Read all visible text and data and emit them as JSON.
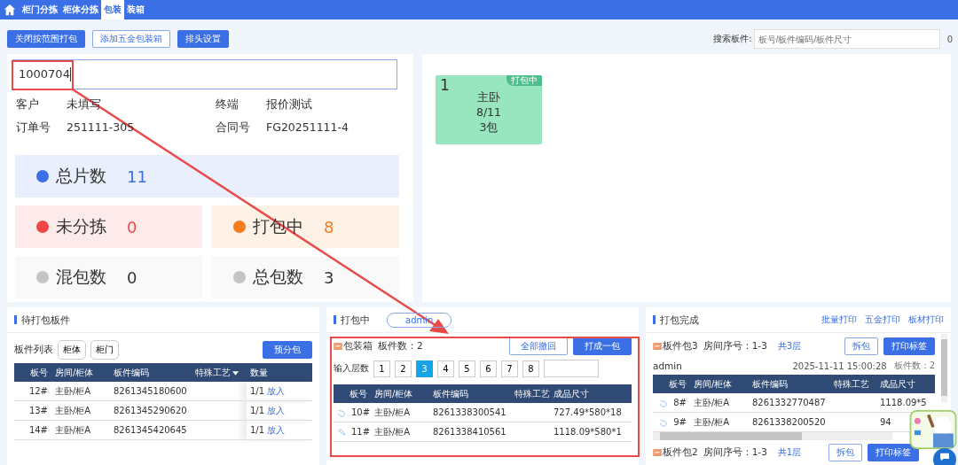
{
  "nav": {
    "tabs": [
      {
        "label": "柜门分拣",
        "selected": false
      },
      {
        "label": "柜体分拣",
        "selected": false
      },
      {
        "label": "包装",
        "selected": true
      },
      {
        "label": "装箱",
        "selected": false
      }
    ]
  },
  "toolbar": {
    "buttons": [
      {
        "label": "关闭按范围打包",
        "kind": "primary"
      },
      {
        "label": "添加五金包装箱",
        "kind": "outline"
      },
      {
        "label": "排头设置",
        "kind": "primary"
      }
    ],
    "search_label": "搜索板件:",
    "search": {
      "placeholder": "板号/板件编码/板件尺寸"
    },
    "count": "0"
  },
  "order": {
    "input": {
      "value": "1000704"
    },
    "info": [
      {
        "label": "客户",
        "value": "未填写"
      },
      {
        "label": "终端",
        "value": "报价测试"
      },
      {
        "label": "订单号",
        "value": "251111-305"
      },
      {
        "label": "合同号",
        "value": "FG20251111-4"
      }
    ],
    "stats": [
      {
        "label": "总片数",
        "value": "11",
        "color": "#3a6fe6"
      },
      {
        "label": "未分拣",
        "value": "0",
        "color": "#f04848"
      },
      {
        "label": "打包中",
        "value": "8",
        "color": "#f57c1f"
      },
      {
        "label": "混包数",
        "value": "0",
        "color": "#c4c4c4"
      },
      {
        "label": "总包数",
        "value": "3",
        "color": "#c4c4c4"
      }
    ]
  },
  "packages": [
    {
      "number": "1",
      "room": "主卧",
      "sorted": "8/11",
      "count": "3包",
      "badge": "打包中"
    }
  ],
  "pending": {
    "title": "待打包板件",
    "list_label": "板件列表",
    "filters": [
      "柜体",
      "柜门"
    ],
    "button": "预分包",
    "columns": [
      "板号",
      "房间/柜体",
      "板件编码",
      "特殊工艺",
      "数量"
    ],
    "rows": [
      {
        "no": "12#",
        "room": "主卧/柜A",
        "code": "8261345180600",
        "qty": "1/1",
        "action": "放入"
      },
      {
        "no": "13#",
        "room": "主卧/柜A",
        "code": "8261345290620",
        "qty": "1/1",
        "action": "放入"
      },
      {
        "no": "14#",
        "room": "主卧/柜A",
        "code": "8261345420645",
        "qty": "1/1",
        "action": "放入"
      }
    ]
  },
  "packing": {
    "title": "打包中",
    "user": "admin",
    "box_label": "包装箱",
    "count_label": "板件数：2",
    "buttons": [
      "全部撤回",
      "打成一包"
    ],
    "layer_label": "输入层数",
    "layers": [
      {
        "label": "1",
        "selected": false
      },
      {
        "label": "2",
        "selected": false
      },
      {
        "label": "3",
        "selected": true
      },
      {
        "label": "4",
        "selected": false
      },
      {
        "label": "5",
        "selected": false
      },
      {
        "label": "6",
        "selected": false
      },
      {
        "label": "7",
        "selected": false
      },
      {
        "label": "8",
        "selected": false
      }
    ],
    "columns": [
      "板号",
      "房间/柜体",
      "板件编码",
      "特殊工艺",
      "成品尺寸"
    ],
    "rows": [
      {
        "no": "10#",
        "room": "主卧/柜A",
        "code": "8261338300541",
        "size": "727.49*580*18"
      },
      {
        "no": "11#",
        "room": "主卧/柜A",
        "code": "8261338410561",
        "size": "1118.09*580*1"
      }
    ]
  },
  "done": {
    "title": "打包完成",
    "links": [
      "批量打印",
      "五金打印",
      "板材打印"
    ],
    "packs": [
      {
        "name": "板件包3",
        "room": "房间序号：1-3",
        "layers": "共3层",
        "buttons": [
          "拆包",
          "打印标签"
        ],
        "user": "admin",
        "time": "2025-11-11 15:00:28",
        "count": "板件数：2",
        "columns": [
          "板号",
          "房间/柜体",
          "板件编码",
          "特殊工艺",
          "成品尺寸"
        ],
        "rows": [
          {
            "no": "8#",
            "room": "主卧/柜A",
            "code": "8261332770487",
            "size": "1118.09*5"
          },
          {
            "no": "9#",
            "room": "主卧/柜A",
            "code": "8261338200520",
            "size": "94"
          }
        ]
      },
      {
        "name": "板件包2",
        "room": "房间序号：1-3",
        "layers": "共1层",
        "buttons": [
          "拆包",
          "打印标签"
        ]
      }
    ]
  }
}
